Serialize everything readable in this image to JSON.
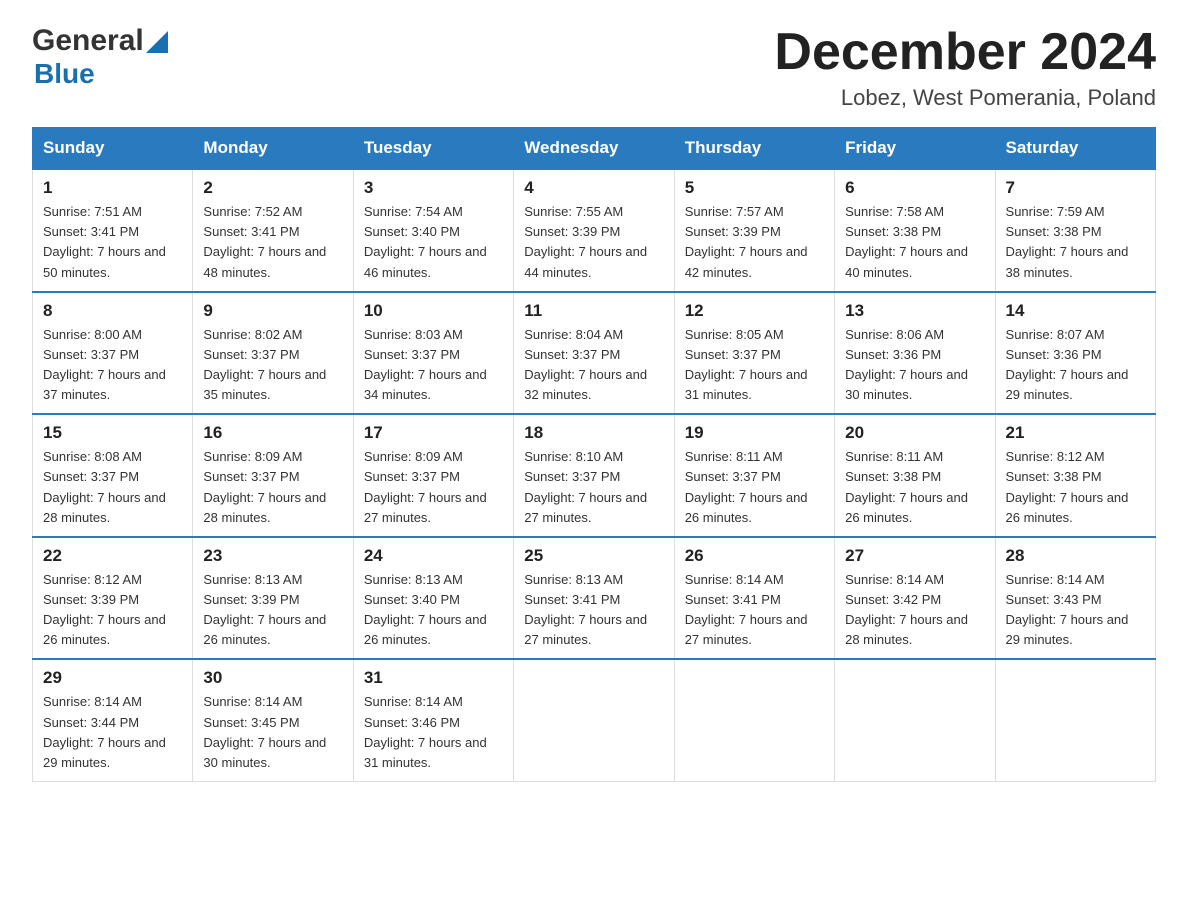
{
  "header": {
    "logo_general": "General",
    "logo_blue": "Blue",
    "month_title": "December 2024",
    "location": "Lobez, West Pomerania, Poland"
  },
  "days_of_week": [
    "Sunday",
    "Monday",
    "Tuesday",
    "Wednesday",
    "Thursday",
    "Friday",
    "Saturday"
  ],
  "weeks": [
    [
      {
        "day": "1",
        "sunrise": "7:51 AM",
        "sunset": "3:41 PM",
        "daylight": "7 hours and 50 minutes."
      },
      {
        "day": "2",
        "sunrise": "7:52 AM",
        "sunset": "3:41 PM",
        "daylight": "7 hours and 48 minutes."
      },
      {
        "day": "3",
        "sunrise": "7:54 AM",
        "sunset": "3:40 PM",
        "daylight": "7 hours and 46 minutes."
      },
      {
        "day": "4",
        "sunrise": "7:55 AM",
        "sunset": "3:39 PM",
        "daylight": "7 hours and 44 minutes."
      },
      {
        "day": "5",
        "sunrise": "7:57 AM",
        "sunset": "3:39 PM",
        "daylight": "7 hours and 42 minutes."
      },
      {
        "day": "6",
        "sunrise": "7:58 AM",
        "sunset": "3:38 PM",
        "daylight": "7 hours and 40 minutes."
      },
      {
        "day": "7",
        "sunrise": "7:59 AM",
        "sunset": "3:38 PM",
        "daylight": "7 hours and 38 minutes."
      }
    ],
    [
      {
        "day": "8",
        "sunrise": "8:00 AM",
        "sunset": "3:37 PM",
        "daylight": "7 hours and 37 minutes."
      },
      {
        "day": "9",
        "sunrise": "8:02 AM",
        "sunset": "3:37 PM",
        "daylight": "7 hours and 35 minutes."
      },
      {
        "day": "10",
        "sunrise": "8:03 AM",
        "sunset": "3:37 PM",
        "daylight": "7 hours and 34 minutes."
      },
      {
        "day": "11",
        "sunrise": "8:04 AM",
        "sunset": "3:37 PM",
        "daylight": "7 hours and 32 minutes."
      },
      {
        "day": "12",
        "sunrise": "8:05 AM",
        "sunset": "3:37 PM",
        "daylight": "7 hours and 31 minutes."
      },
      {
        "day": "13",
        "sunrise": "8:06 AM",
        "sunset": "3:36 PM",
        "daylight": "7 hours and 30 minutes."
      },
      {
        "day": "14",
        "sunrise": "8:07 AM",
        "sunset": "3:36 PM",
        "daylight": "7 hours and 29 minutes."
      }
    ],
    [
      {
        "day": "15",
        "sunrise": "8:08 AM",
        "sunset": "3:37 PM",
        "daylight": "7 hours and 28 minutes."
      },
      {
        "day": "16",
        "sunrise": "8:09 AM",
        "sunset": "3:37 PM",
        "daylight": "7 hours and 28 minutes."
      },
      {
        "day": "17",
        "sunrise": "8:09 AM",
        "sunset": "3:37 PM",
        "daylight": "7 hours and 27 minutes."
      },
      {
        "day": "18",
        "sunrise": "8:10 AM",
        "sunset": "3:37 PM",
        "daylight": "7 hours and 27 minutes."
      },
      {
        "day": "19",
        "sunrise": "8:11 AM",
        "sunset": "3:37 PM",
        "daylight": "7 hours and 26 minutes."
      },
      {
        "day": "20",
        "sunrise": "8:11 AM",
        "sunset": "3:38 PM",
        "daylight": "7 hours and 26 minutes."
      },
      {
        "day": "21",
        "sunrise": "8:12 AM",
        "sunset": "3:38 PM",
        "daylight": "7 hours and 26 minutes."
      }
    ],
    [
      {
        "day": "22",
        "sunrise": "8:12 AM",
        "sunset": "3:39 PM",
        "daylight": "7 hours and 26 minutes."
      },
      {
        "day": "23",
        "sunrise": "8:13 AM",
        "sunset": "3:39 PM",
        "daylight": "7 hours and 26 minutes."
      },
      {
        "day": "24",
        "sunrise": "8:13 AM",
        "sunset": "3:40 PM",
        "daylight": "7 hours and 26 minutes."
      },
      {
        "day": "25",
        "sunrise": "8:13 AM",
        "sunset": "3:41 PM",
        "daylight": "7 hours and 27 minutes."
      },
      {
        "day": "26",
        "sunrise": "8:14 AM",
        "sunset": "3:41 PM",
        "daylight": "7 hours and 27 minutes."
      },
      {
        "day": "27",
        "sunrise": "8:14 AM",
        "sunset": "3:42 PM",
        "daylight": "7 hours and 28 minutes."
      },
      {
        "day": "28",
        "sunrise": "8:14 AM",
        "sunset": "3:43 PM",
        "daylight": "7 hours and 29 minutes."
      }
    ],
    [
      {
        "day": "29",
        "sunrise": "8:14 AM",
        "sunset": "3:44 PM",
        "daylight": "7 hours and 29 minutes."
      },
      {
        "day": "30",
        "sunrise": "8:14 AM",
        "sunset": "3:45 PM",
        "daylight": "7 hours and 30 minutes."
      },
      {
        "day": "31",
        "sunrise": "8:14 AM",
        "sunset": "3:46 PM",
        "daylight": "7 hours and 31 minutes."
      },
      null,
      null,
      null,
      null
    ]
  ]
}
